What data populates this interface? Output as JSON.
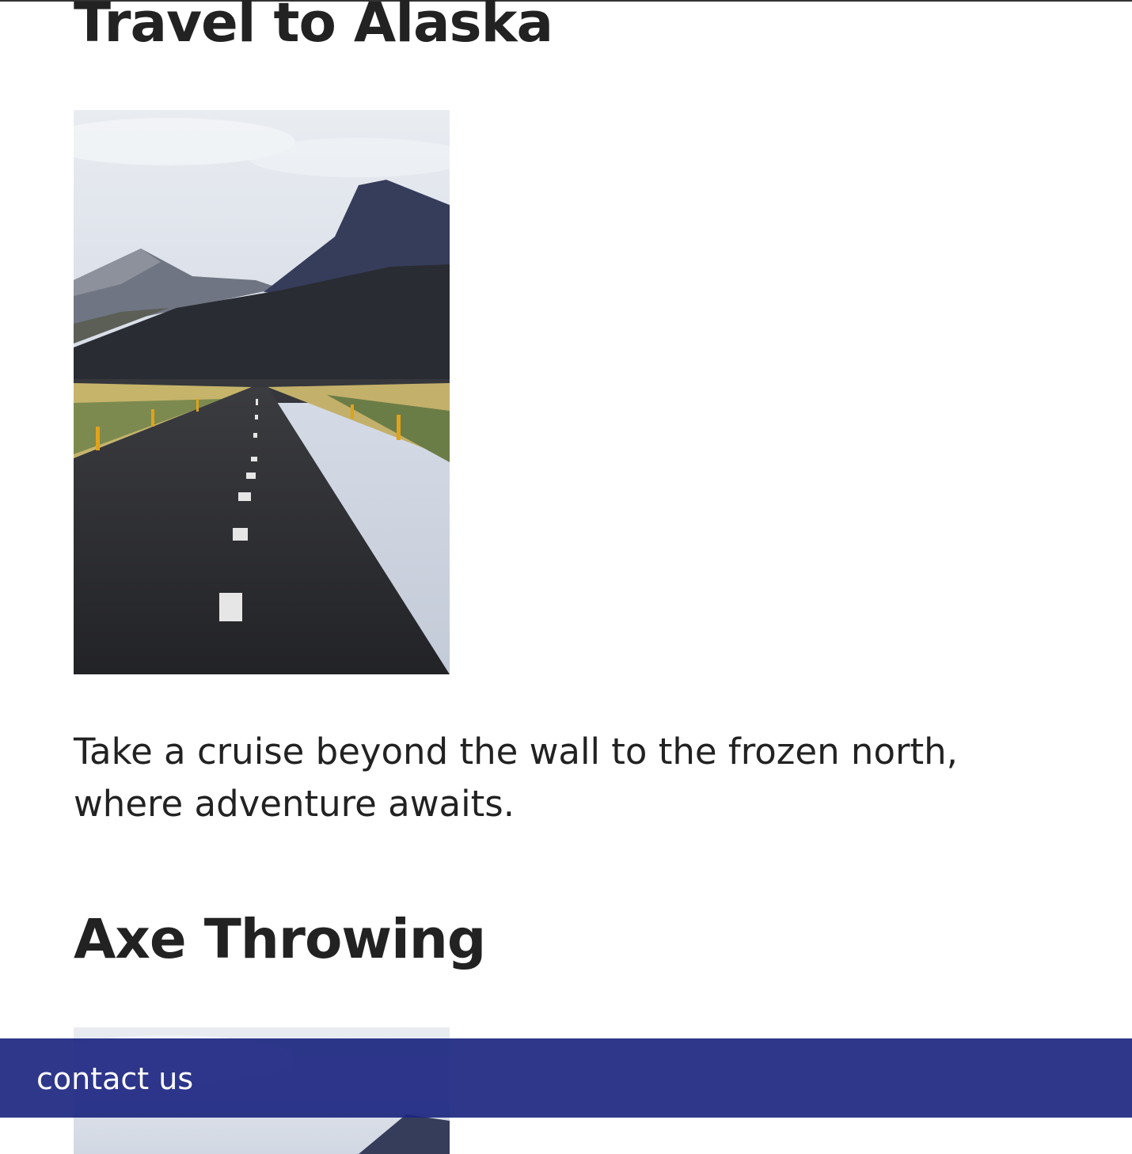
{
  "cards": [
    {
      "title": "Travel to Alaska",
      "description": "Take a cruise beyond the wall to the frozen north, where adventure awaits."
    },
    {
      "title": "Axe Throwing"
    }
  ],
  "footer": {
    "contact_label": "contact us",
    "background_color": "#2c3585"
  },
  "colors": {
    "text": "#222222",
    "background": "#ffffff"
  }
}
